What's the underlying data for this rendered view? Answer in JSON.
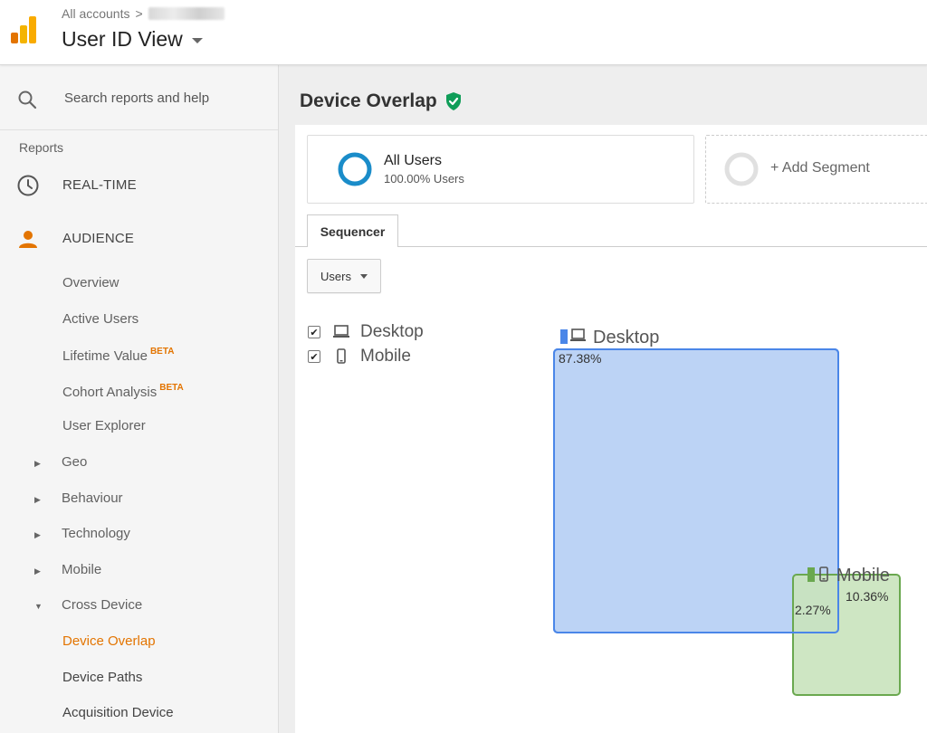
{
  "header": {
    "breadcrumb": "All accounts",
    "breadcrumb_sep": ">",
    "view_title": "User ID View"
  },
  "sidebar": {
    "search_placeholder": "Search reports and help",
    "reports_label": "Reports",
    "realtime": "REAL-TIME",
    "audience": "AUDIENCE",
    "audience_items": [
      {
        "label": "Overview"
      },
      {
        "label": "Active Users"
      },
      {
        "label": "Lifetime Value",
        "badge": "BETA"
      },
      {
        "label": "Cohort Analysis",
        "badge": "BETA"
      },
      {
        "label": "User Explorer"
      }
    ],
    "expandables": [
      {
        "label": "Geo",
        "arrow": "▶"
      },
      {
        "label": "Behaviour",
        "arrow": "▶"
      },
      {
        "label": "Technology",
        "arrow": "▶"
      },
      {
        "label": "Mobile",
        "arrow": "▶"
      },
      {
        "label": "Cross Device",
        "arrow": "▼"
      }
    ],
    "cross_device_items": [
      {
        "label": "Device Overlap",
        "active": true
      },
      {
        "label": "Device Paths"
      },
      {
        "label": "Acquisition Device"
      }
    ]
  },
  "main": {
    "page_title": "Device Overlap",
    "segment": {
      "name": "All Users",
      "sub": "100.00% Users"
    },
    "add_segment": "+ Add Segment",
    "tab": "Sequencer",
    "metric": "Users",
    "devices": [
      {
        "label": "Desktop",
        "checked": true,
        "checkmark": "✔"
      },
      {
        "label": "Mobile",
        "checked": true,
        "checkmark": "✔"
      }
    ]
  },
  "colors": {
    "accent_orange": "#e37400",
    "desktop_fill": "#bcd3f5",
    "desktop_stroke": "#4a86e8",
    "mobile_fill": "#c9e3bd",
    "mobile_stroke": "#6aa84f",
    "segment_ring": "#1a8cc9",
    "verified_green": "#0f9d58"
  },
  "chart_data": {
    "type": "venn",
    "sets": [
      {
        "name": "Desktop",
        "label": "87.38%",
        "value": 87.38
      },
      {
        "name": "Mobile",
        "label": "10.36%",
        "value": 10.36
      }
    ],
    "overlap": {
      "sets": [
        "Desktop",
        "Mobile"
      ],
      "label": "2.27%",
      "value": 2.27
    }
  }
}
